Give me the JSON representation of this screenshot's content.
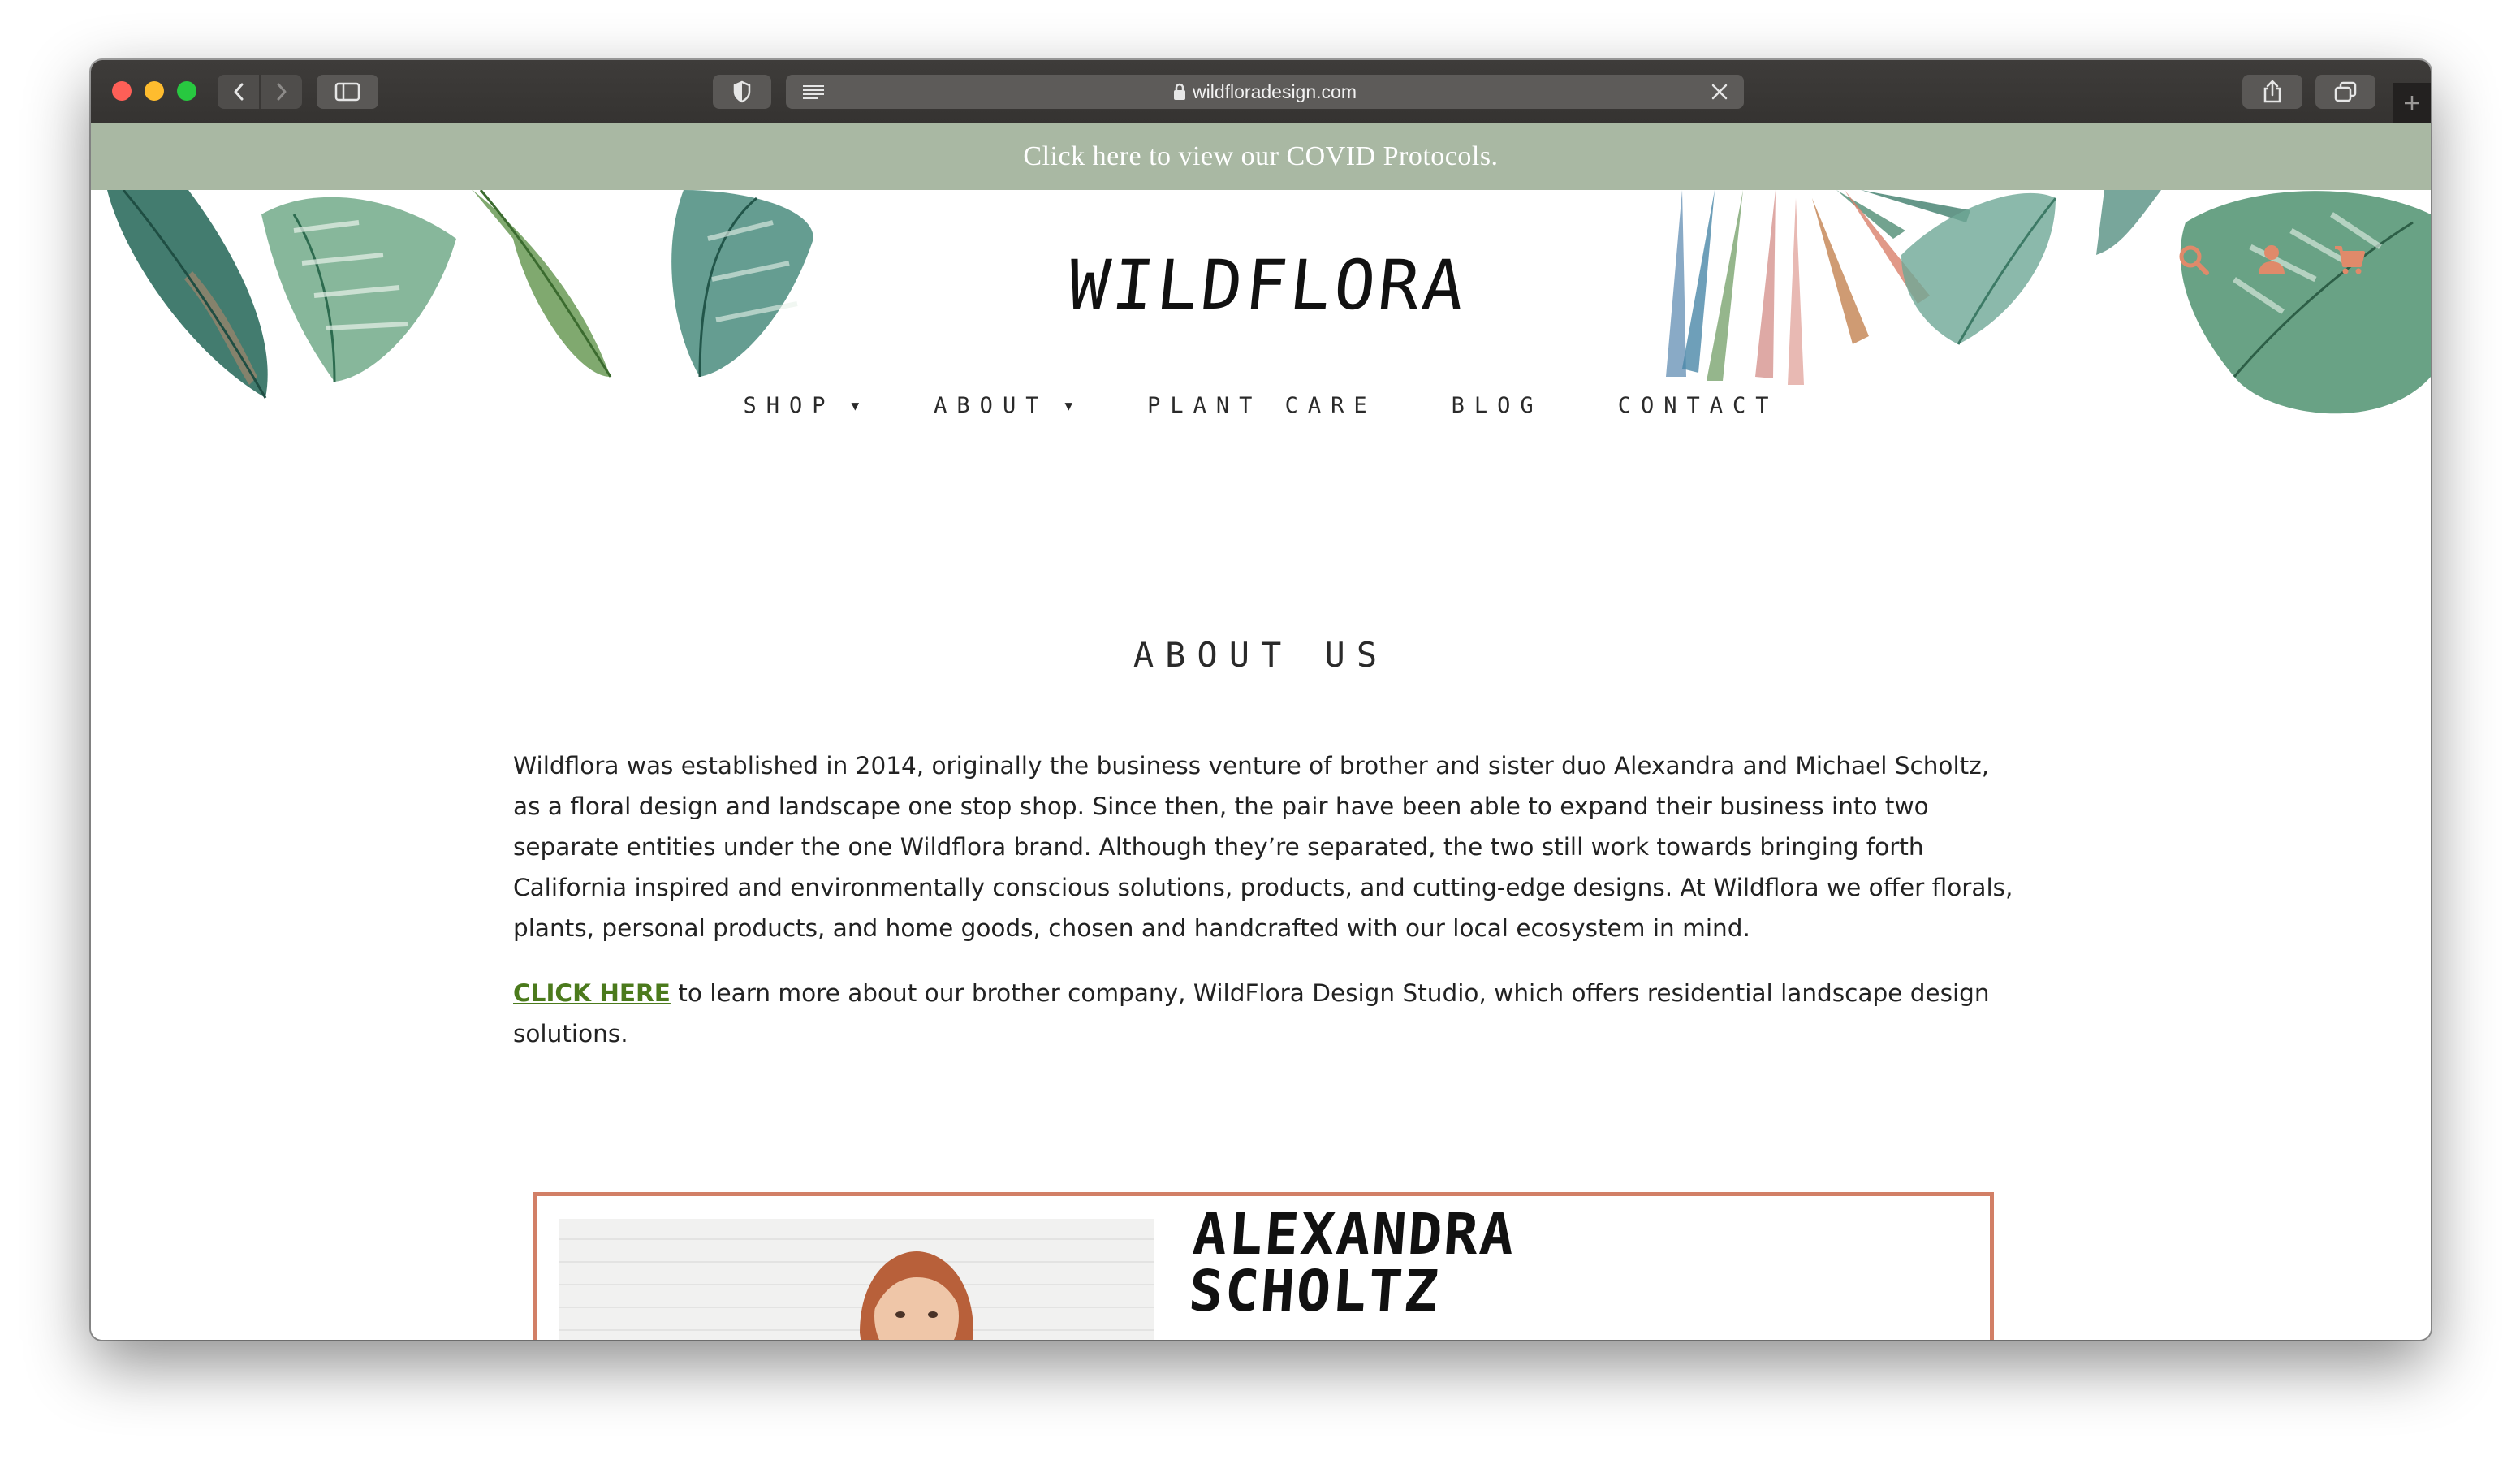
{
  "browser": {
    "url": "wildfloradesign.com"
  },
  "banner": {
    "text": "Click here to view our COVID Protocols."
  },
  "header": {
    "logo_text": "WILDFLORA",
    "icons": [
      "search-icon",
      "account-icon",
      "cart-icon"
    ],
    "icon_color": "#e08a6a"
  },
  "nav": {
    "items": [
      {
        "label": "SHOP",
        "has_dropdown": true
      },
      {
        "label": "ABOUT",
        "has_dropdown": true
      },
      {
        "label": "PLANT CARE",
        "has_dropdown": false
      },
      {
        "label": "BLOG",
        "has_dropdown": false
      },
      {
        "label": "CONTACT",
        "has_dropdown": false
      }
    ]
  },
  "main": {
    "title": "ABOUT US",
    "paragraph1": "Wildflora was established in 2014, originally the business venture of brother and sister duo Alexandra and Michael Scholtz, as a floral design and landscape one stop shop. Since then, the pair have been able to expand their business into two separate entities under the one Wildflora brand. Although they’re separated, the two still work towards bringing forth California inspired and environmentally conscious solutions, products, and cutting-edge designs. At Wildflora we offer florals, plants, personal products, and home goods, chosen and handcrafted with our local ecosystem in mind.",
    "link_text": "CLICK HERE",
    "paragraph2_rest": " to learn more about our brother company, WildFlora Design Studio, which offers residential landscape design solutions."
  },
  "profile": {
    "name_line1": "ALEXANDRA",
    "name_line2": "SCHOLTZ",
    "border_color": "#d27f66"
  },
  "colors": {
    "banner_bg": "#a9b8a3",
    "link": "#4b7a1c",
    "chrome": "#3e3c3a"
  }
}
